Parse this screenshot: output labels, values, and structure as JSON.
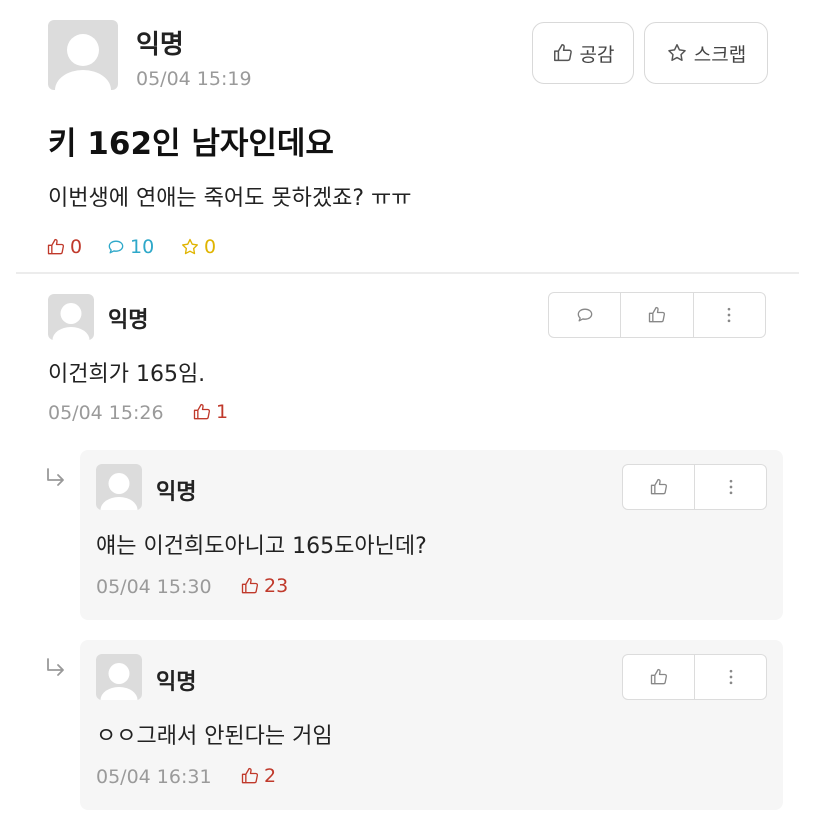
{
  "post": {
    "author": "익명",
    "timestamp": "05/04 15:19",
    "title": "키 162인 남자인데요",
    "body": "이번생에 연애는 죽어도 못하겠죠? ㅠㅠ",
    "like_button_label": "공감",
    "scrap_button_label": "스크랩",
    "like_count": "0",
    "comment_count": "10",
    "scrap_count": "0"
  },
  "comments": [
    {
      "author": "익명",
      "text": "이건희가 165임.",
      "timestamp": "05/04 15:26",
      "likes": "1"
    }
  ],
  "replies": [
    {
      "author": "익명",
      "text": "얘는 이건희도아니고 165도아닌데?",
      "timestamp": "05/04 15:30",
      "likes": "23"
    },
    {
      "author": "익명",
      "text": "ㅇㅇ그래서 안된다는 거임",
      "timestamp": "05/04 16:31",
      "likes": "2"
    }
  ],
  "colors": {
    "like_red": "#c0392b",
    "comment_teal": "#2ea8c9",
    "scrap_yellow": "#e0b400",
    "meta_gray": "#9a9a9a"
  },
  "icons": {
    "thumbs_up": "thumbs-up-icon",
    "star": "star-icon",
    "speech_bubble": "speech-bubble-icon",
    "more": "more-vertical-icon",
    "reply_arrow": "reply-arrow-icon"
  }
}
